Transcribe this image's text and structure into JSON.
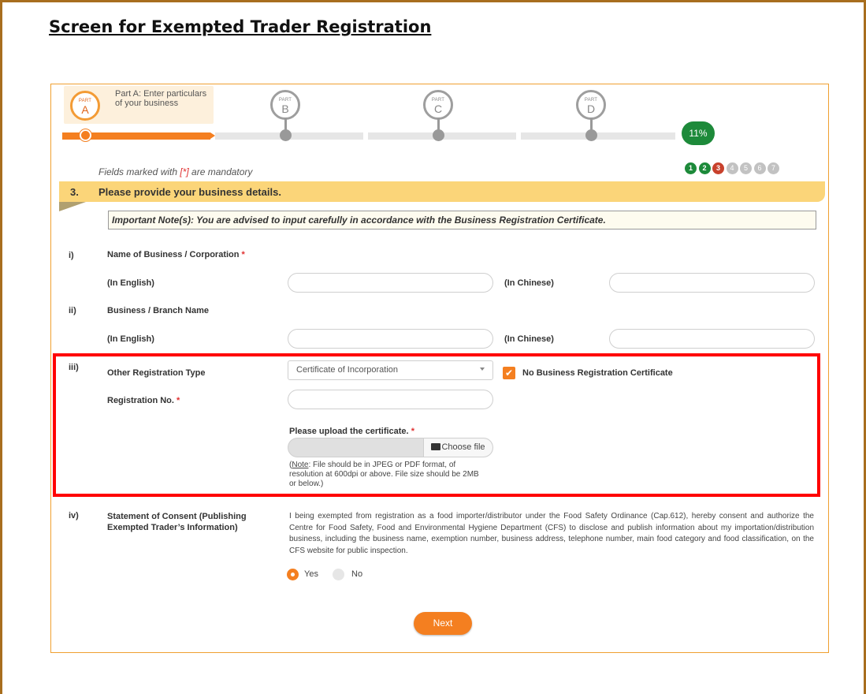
{
  "document": {
    "title": "Screen for Exempted Trader Registration"
  },
  "progress": {
    "parts": [
      {
        "part_label": "PART",
        "letter": "A",
        "description": "Part A: Enter particulars of your business"
      },
      {
        "part_label": "PART",
        "letter": "B"
      },
      {
        "part_label": "PART",
        "letter": "C"
      },
      {
        "part_label": "PART",
        "letter": "D"
      }
    ],
    "percent": "11%",
    "steps": [
      "1",
      "2",
      "3",
      "4",
      "5",
      "6",
      "7"
    ]
  },
  "mandatory_note": {
    "prefix": "Fields marked with ",
    "star": "[*]",
    "suffix": " are mandatory"
  },
  "section": {
    "number": "3.",
    "title": "Please provide your business details."
  },
  "important_note": "Important Note(s): You are advised to input carefully in accordance with the Business Registration Certificate.",
  "fields": {
    "name": {
      "num": "i)",
      "label": "Name of Business / Corporation",
      "star": "*",
      "en_label": "(In English)",
      "zh_label": "(In Chinese)"
    },
    "branch": {
      "num": "ii)",
      "label": "Business / Branch Name",
      "en_label": "(In English)",
      "zh_label": "(In Chinese)"
    },
    "other_reg": {
      "num": "iii)",
      "label": "Other Registration Type",
      "selected": "Certificate of Incorporation",
      "checkbox_label": "No Business Registration Certificate",
      "reg_no_label": "Registration No.",
      "star": "*",
      "upload_label": "Please upload the certificate.",
      "choose_file": "Choose file",
      "note_word": "Note",
      "note_text": ": File should be in JPEG or PDF format, of resolution at 600dpi or above. File size should be 2MB or below.)"
    },
    "consent": {
      "num": "iv)",
      "label_line1": "Statement of Consent (Publishing",
      "label_line2": "Exempted Trader’s Information)",
      "text": "I being exempted from registration as a food importer/distributor under the Food Safety Ordinance (Cap.612), hereby consent and authorize the Centre for Food Safety, Food and Environmental Hygiene Department (CFS) to disclose and publish information about my importation/distribution business, including the business name, exemption number, business address, telephone number, main food category and food classification, on the CFS website for public inspection.",
      "yes": "Yes",
      "no": "No"
    }
  },
  "buttons": {
    "next": "Next"
  },
  "colors": {
    "accent": "#f47f20",
    "progress_green": "#1d8a3a",
    "section_bar": "#fbd579",
    "highlight_border": "#ff0000",
    "frame_brown": "#a86e1e"
  }
}
